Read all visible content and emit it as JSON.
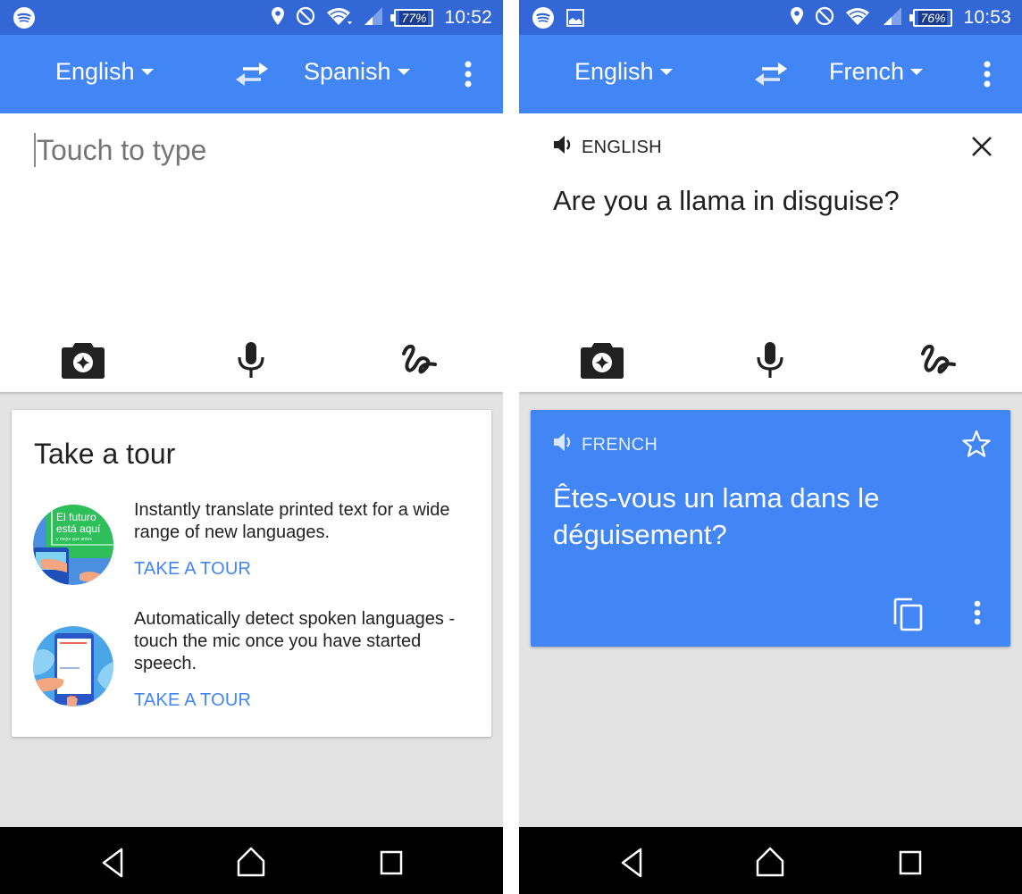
{
  "colors": {
    "status_bar": "#3367d6",
    "toolbar": "#4285f4",
    "accent": "#4285f4",
    "result_card": "#4285f4",
    "background": "#e3e3e3",
    "nav_bar": "#000000"
  },
  "left_screen": {
    "status_bar": {
      "notification_icons": [
        "spotify-icon"
      ],
      "system_icons": [
        "location-icon",
        "do-not-disturb-icon",
        "wifi-icon",
        "cell-signal-icon"
      ],
      "battery_percent": "77%",
      "battery_level": 0.77,
      "time": "10:52"
    },
    "toolbar": {
      "source_language": "English",
      "target_language": "Spanish",
      "swap_icon": "swap-arrows-icon",
      "menu_icon": "more-vert-icon"
    },
    "input": {
      "placeholder": "Touch to type",
      "tools": [
        "camera-icon",
        "microphone-icon",
        "handwriting-icon"
      ]
    },
    "tour_card": {
      "title": "Take a tour",
      "items": [
        {
          "image": "camera-translate-illustration",
          "image_text": [
            "El futuro",
            "está aquí",
            "y mejor que antes"
          ],
          "description": "Instantly translate printed text for a wide range of new languages.",
          "cta": "TAKE A TOUR"
        },
        {
          "image": "conversation-illustration",
          "description": "Automatically detect spoken languages - touch the mic once you have started speech.",
          "cta": "TAKE A TOUR"
        }
      ]
    },
    "nav_bar": [
      "back-icon",
      "home-icon",
      "recents-icon"
    ]
  },
  "right_screen": {
    "status_bar": {
      "notification_icons": [
        "spotify-icon",
        "image-icon"
      ],
      "system_icons": [
        "location-icon",
        "do-not-disturb-icon",
        "wifi-icon",
        "cell-signal-icon"
      ],
      "battery_percent": "76%",
      "battery_level": 0.76,
      "time": "10:53"
    },
    "toolbar": {
      "source_language": "English",
      "target_language": "French",
      "swap_icon": "swap-arrows-icon",
      "menu_icon": "more-vert-icon"
    },
    "input": {
      "language_label": "ENGLISH",
      "text": "Are you a llama in disguise?",
      "tools": [
        "camera-icon",
        "microphone-icon",
        "handwriting-icon"
      ]
    },
    "result_card": {
      "language_label": "FRENCH",
      "text": "Êtes-vous un lama dans le déguisement?",
      "actions": [
        "star-icon",
        "copy-icon",
        "more-vert-icon"
      ]
    },
    "nav_bar": [
      "back-icon",
      "home-icon",
      "recents-icon"
    ]
  }
}
